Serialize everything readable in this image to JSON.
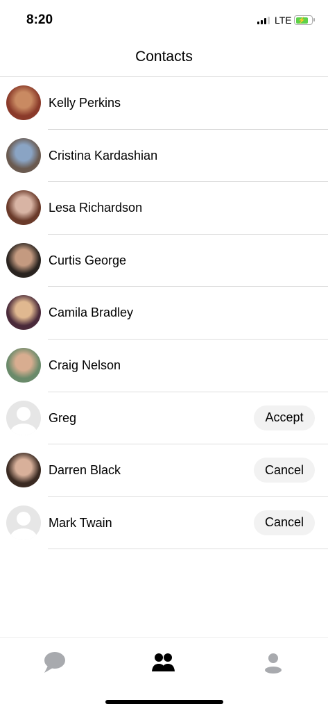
{
  "status": {
    "time": "8:20",
    "network": "LTE"
  },
  "header": {
    "title": "Contacts"
  },
  "contacts": [
    {
      "name": "Kelly Perkins",
      "photo": true,
      "c1": "#c98a62",
      "c2": "#8a3a2a"
    },
    {
      "name": "Cristina Kardashian",
      "photo": true,
      "c1": "#8aa4c4",
      "c2": "#6a5a50"
    },
    {
      "name": "Lesa Richardson",
      "photo": true,
      "c1": "#d8b4a4",
      "c2": "#6a3a2a"
    },
    {
      "name": "Curtis George",
      "photo": true,
      "c1": "#c49a80",
      "c2": "#2a2420"
    },
    {
      "name": "Camila Bradley",
      "photo": true,
      "c1": "#e0b890",
      "c2": "#4a2a3a"
    },
    {
      "name": "Craig Nelson",
      "photo": true,
      "c1": "#d8ad90",
      "c2": "#6a8a6a"
    },
    {
      "name": "Greg",
      "photo": false,
      "action": "Accept"
    },
    {
      "name": "Darren Black",
      "photo": true,
      "c1": "#d8b09a",
      "c2": "#3a2a22",
      "action": "Cancel"
    },
    {
      "name": "Mark Twain",
      "photo": false,
      "action": "Cancel"
    }
  ],
  "tabs": [
    {
      "name": "chats",
      "icon": "chat-bubble-icon"
    },
    {
      "name": "contacts",
      "icon": "contacts-icon",
      "active": true
    },
    {
      "name": "profile",
      "icon": "person-icon"
    }
  ]
}
